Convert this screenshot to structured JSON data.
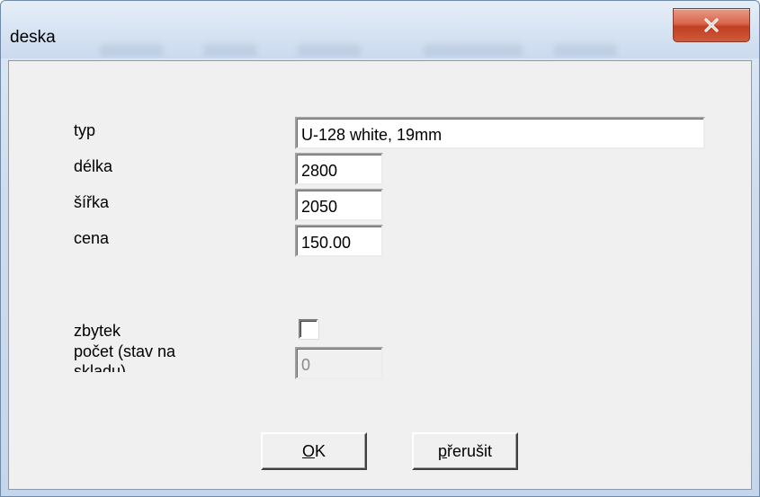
{
  "window": {
    "title": "deska"
  },
  "form": {
    "typ": {
      "label": "typ",
      "value": "U-128 white, 19mm"
    },
    "delka": {
      "label": "délka",
      "value": "2800"
    },
    "sirka": {
      "label": "šířka",
      "value": "2050"
    },
    "cena": {
      "label": "cena",
      "value": "150.00"
    },
    "zbytek": {
      "label": "zbytek",
      "checked": false
    },
    "pocet": {
      "label_line1": "počet (stav na",
      "label_line2": "skladu)",
      "value": "0",
      "disabled": true
    }
  },
  "buttons": {
    "ok": {
      "mnemonic": "O",
      "rest": "K"
    },
    "cancel": {
      "mnemonic": "p",
      "rest": "řerušit"
    }
  },
  "colors": {
    "close_button": "#c74a2e",
    "dialog_face": "#f0f0f0",
    "titlebar": "#d6e3f2"
  },
  "icons": {
    "close": "close-icon"
  }
}
